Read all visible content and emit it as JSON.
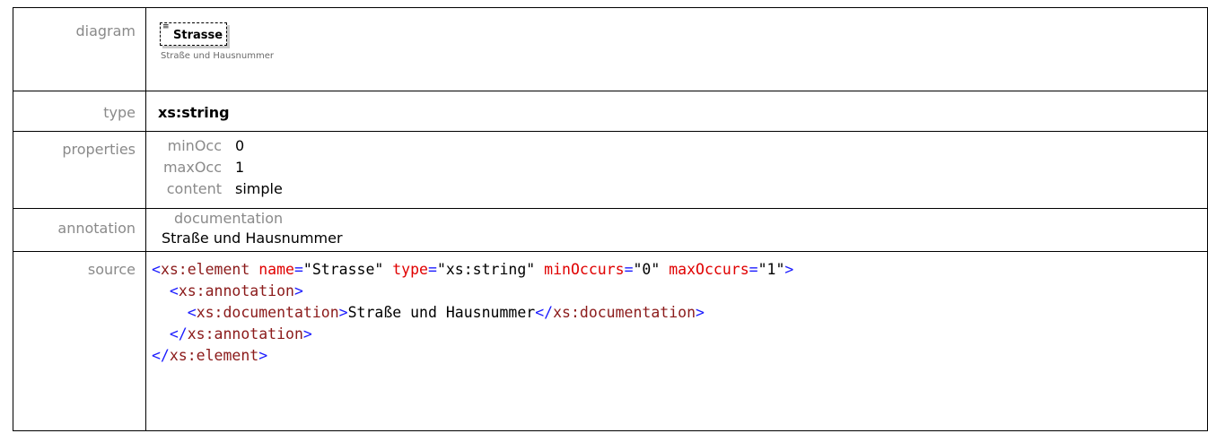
{
  "rows": {
    "diagram": {
      "label": "diagram",
      "element_name": "Strasse",
      "element_doc": "Straße und Hausnummer"
    },
    "type": {
      "label": "type",
      "value": "xs:string"
    },
    "properties": {
      "label": "properties",
      "items": [
        {
          "key": "minOcc",
          "value": "0"
        },
        {
          "key": "maxOcc",
          "value": "1"
        },
        {
          "key": "content",
          "value": "simple"
        }
      ]
    },
    "annotation": {
      "label": "annotation",
      "heading": "documentation",
      "text": "Straße und Hausnummer"
    },
    "source": {
      "label": "source",
      "lines": [
        {
          "indent": "",
          "open": "<",
          "tag": "xs:element",
          "a1": "name",
          "eq1": "=",
          "v1": "\"Strasse\"",
          "a2": "type",
          "eq2": "=",
          "v2": "\"xs:string\"",
          "a3": "minOccurs",
          "eq3": "=",
          "v3": "\"0\"",
          "a4": "maxOccurs",
          "eq4": "=",
          "v4": "\"1\"",
          "close": ">"
        },
        {
          "indent": "  ",
          "open": "<",
          "tag": "xs:annotation",
          "close": ">"
        },
        {
          "indent": "    ",
          "open": "<",
          "tag": "xs:documentation",
          "close": ">",
          "text": "Straße und Hausnummer",
          "open2": "</",
          "tag2": "xs:documentation",
          "close2": ">"
        },
        {
          "indent": "  ",
          "open": "</",
          "tag": "xs:annotation",
          "close": ">"
        },
        {
          "indent": "",
          "open": "</",
          "tag": "xs:element",
          "close": ">"
        }
      ]
    }
  },
  "colors": {
    "bracket": "#1a1aff",
    "tag": "#8b1a1a",
    "attribute": "#e00000",
    "label_gray": "#8a8a8a"
  }
}
